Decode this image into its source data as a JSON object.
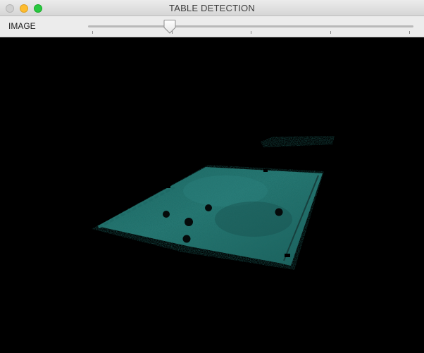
{
  "window": {
    "title": "TABLE DETECTION",
    "controls": {
      "close_icon": "close-icon",
      "minimize_icon": "minimize-icon",
      "zoom_icon": "zoom-icon"
    }
  },
  "toolbar": {
    "trackbar_label": "IMAGE",
    "trackbar": {
      "value_fraction": 0.25,
      "tick_count": 5
    }
  },
  "image": {
    "description_icon": "image-display",
    "background_color": "#000000",
    "table_color": "#1f6e6a",
    "ball_count": 5
  }
}
